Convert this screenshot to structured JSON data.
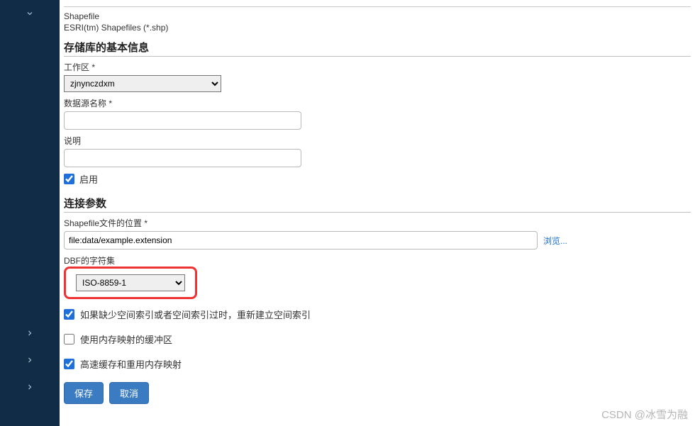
{
  "header": {
    "shapefile_title": "Shapefile",
    "shapefile_sub": "ESRI(tm) Shapefiles (*.shp)"
  },
  "basic": {
    "section_title": "存储库的基本信息",
    "workspace_label": "工作区 *",
    "workspace_value": "zjnynczdxm",
    "dsname_label": "数据源名称 *",
    "dsname_value": "",
    "desc_label": "说明",
    "desc_value": "",
    "enable_label": "启用",
    "enable_checked": true
  },
  "conn": {
    "section_title": "连接参数",
    "loc_label": "Shapefile文件的位置 *",
    "loc_value": "file:data/example.extension",
    "browse_label": "浏览...",
    "charset_label": "DBF的字符集",
    "charset_value": "ISO-8859-1",
    "opt1_label": "如果缺少空间索引或者空间索引过时，重新建立空间索引",
    "opt1_checked": true,
    "opt2_label": "使用内存映射的缓冲区",
    "opt2_checked": false,
    "opt3_label": "高速缓存和重用内存映射",
    "opt3_checked": true
  },
  "buttons": {
    "save": "保存",
    "cancel": "取消"
  },
  "watermark": "CSDN @冰雪为融"
}
